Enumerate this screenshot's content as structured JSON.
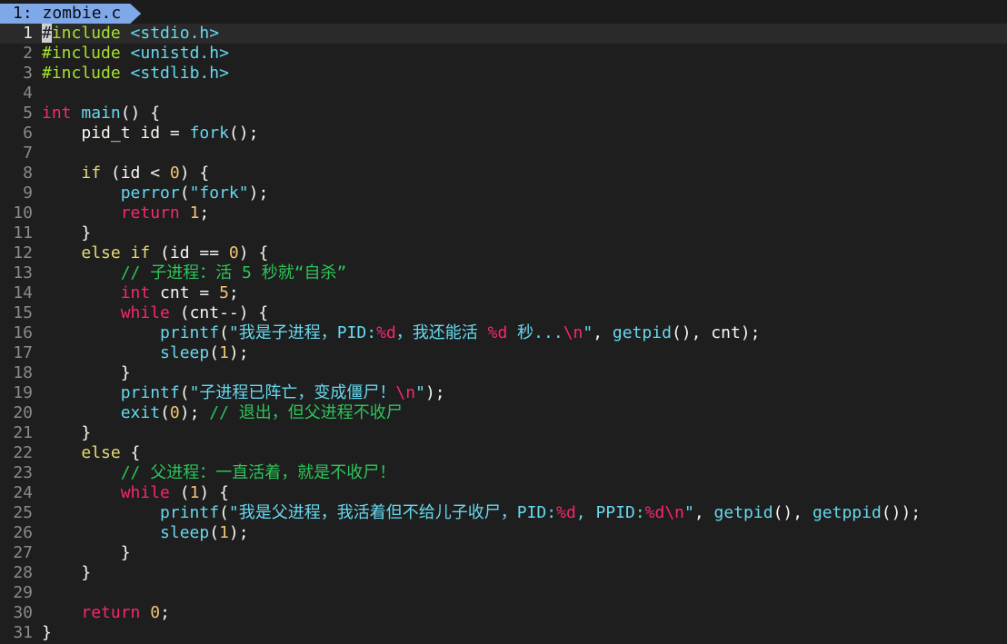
{
  "tab": {
    "label": "1: zombie.c"
  },
  "colors": {
    "tab_bg": "#7fa8e8",
    "background": "#1e1e1e",
    "comment": "#2cc55a"
  },
  "lines": [
    {
      "n": "1",
      "current": true,
      "parts": [
        [
          "cursor",
          "#"
        ],
        [
          "pp",
          "include"
        ],
        [
          "txt",
          " "
        ],
        [
          "hdr",
          "<stdio.h>"
        ]
      ]
    },
    {
      "n": "2",
      "parts": [
        [
          "pp",
          "#include"
        ],
        [
          "txt",
          " "
        ],
        [
          "hdr",
          "<unistd.h>"
        ]
      ]
    },
    {
      "n": "3",
      "parts": [
        [
          "pp",
          "#include"
        ],
        [
          "txt",
          " "
        ],
        [
          "hdr",
          "<stdlib.h>"
        ]
      ]
    },
    {
      "n": "4",
      "parts": []
    },
    {
      "n": "5",
      "parts": [
        [
          "kw",
          "int"
        ],
        [
          "txt",
          " "
        ],
        [
          "fn",
          "main"
        ],
        [
          "txt",
          "() {"
        ]
      ]
    },
    {
      "n": "6",
      "parts": [
        [
          "txt",
          "    pid_t id = "
        ],
        [
          "fn",
          "fork"
        ],
        [
          "txt",
          "();"
        ]
      ]
    },
    {
      "n": "7",
      "parts": []
    },
    {
      "n": "8",
      "parts": [
        [
          "txt",
          "    "
        ],
        [
          "kw2",
          "if"
        ],
        [
          "txt",
          " (id < "
        ],
        [
          "num",
          "0"
        ],
        [
          "txt",
          ") {"
        ]
      ]
    },
    {
      "n": "9",
      "parts": [
        [
          "txt",
          "        "
        ],
        [
          "fn",
          "perror"
        ],
        [
          "txt",
          "("
        ],
        [
          "str",
          "\"fork\""
        ],
        [
          "txt",
          ");"
        ]
      ]
    },
    {
      "n": "10",
      "parts": [
        [
          "txt",
          "        "
        ],
        [
          "kw",
          "return"
        ],
        [
          "txt",
          " "
        ],
        [
          "num",
          "1"
        ],
        [
          "txt",
          ";"
        ]
      ]
    },
    {
      "n": "11",
      "parts": [
        [
          "txt",
          "    }"
        ]
      ]
    },
    {
      "n": "12",
      "parts": [
        [
          "txt",
          "    "
        ],
        [
          "kw2",
          "else if"
        ],
        [
          "txt",
          " (id == "
        ],
        [
          "num",
          "0"
        ],
        [
          "txt",
          ") {"
        ]
      ]
    },
    {
      "n": "13",
      "parts": [
        [
          "txt",
          "        "
        ],
        [
          "cm",
          "// 子进程：活 5 秒就“自杀”"
        ]
      ]
    },
    {
      "n": "14",
      "parts": [
        [
          "txt",
          "        "
        ],
        [
          "kw",
          "int"
        ],
        [
          "txt",
          " cnt = "
        ],
        [
          "num",
          "5"
        ],
        [
          "txt",
          ";"
        ]
      ]
    },
    {
      "n": "15",
      "parts": [
        [
          "txt",
          "        "
        ],
        [
          "kw",
          "while"
        ],
        [
          "txt",
          " (cnt--) {"
        ]
      ]
    },
    {
      "n": "16",
      "parts": [
        [
          "txt",
          "            "
        ],
        [
          "fn",
          "printf"
        ],
        [
          "txt",
          "("
        ],
        [
          "str",
          "\"我是子进程，PID:"
        ],
        [
          "fmt",
          "%d"
        ],
        [
          "str",
          "，我还能活 "
        ],
        [
          "fmt",
          "%d"
        ],
        [
          "str",
          " 秒..."
        ],
        [
          "fmt",
          "\\n"
        ],
        [
          "str",
          "\""
        ],
        [
          "txt",
          ", "
        ],
        [
          "fn",
          "getpid"
        ],
        [
          "txt",
          "(), cnt);"
        ]
      ]
    },
    {
      "n": "17",
      "parts": [
        [
          "txt",
          "            "
        ],
        [
          "fn",
          "sleep"
        ],
        [
          "txt",
          "("
        ],
        [
          "num",
          "1"
        ],
        [
          "txt",
          ");"
        ]
      ]
    },
    {
      "n": "18",
      "parts": [
        [
          "txt",
          "        }"
        ]
      ]
    },
    {
      "n": "19",
      "parts": [
        [
          "txt",
          "        "
        ],
        [
          "fn",
          "printf"
        ],
        [
          "txt",
          "("
        ],
        [
          "str",
          "\"子进程已阵亡，变成僵尸！"
        ],
        [
          "fmt",
          "\\n"
        ],
        [
          "str",
          "\""
        ],
        [
          "txt",
          ");"
        ]
      ]
    },
    {
      "n": "20",
      "parts": [
        [
          "txt",
          "        "
        ],
        [
          "fn",
          "exit"
        ],
        [
          "txt",
          "("
        ],
        [
          "num",
          "0"
        ],
        [
          "txt",
          "); "
        ],
        [
          "cm",
          "// 退出，但父进程不收尸"
        ]
      ]
    },
    {
      "n": "21",
      "parts": [
        [
          "txt",
          "    }"
        ]
      ]
    },
    {
      "n": "22",
      "parts": [
        [
          "txt",
          "    "
        ],
        [
          "kw2",
          "else"
        ],
        [
          "txt",
          " {"
        ]
      ]
    },
    {
      "n": "23",
      "parts": [
        [
          "txt",
          "        "
        ],
        [
          "cm",
          "// 父进程：一直活着，就是不收尸！"
        ]
      ]
    },
    {
      "n": "24",
      "parts": [
        [
          "txt",
          "        "
        ],
        [
          "kw",
          "while"
        ],
        [
          "txt",
          " ("
        ],
        [
          "num",
          "1"
        ],
        [
          "txt",
          ") {"
        ]
      ]
    },
    {
      "n": "25",
      "parts": [
        [
          "txt",
          "            "
        ],
        [
          "fn",
          "printf"
        ],
        [
          "txt",
          "("
        ],
        [
          "str",
          "\"我是父进程，我活着但不给儿子收尸，PID:"
        ],
        [
          "fmt",
          "%d"
        ],
        [
          "str",
          ", PPID:"
        ],
        [
          "fmt",
          "%d\\n"
        ],
        [
          "str",
          "\""
        ],
        [
          "txt",
          ", "
        ],
        [
          "fn",
          "getpid"
        ],
        [
          "txt",
          "(), "
        ],
        [
          "fn",
          "getppid"
        ],
        [
          "txt",
          "());"
        ]
      ]
    },
    {
      "n": "26",
      "parts": [
        [
          "txt",
          "            "
        ],
        [
          "fn",
          "sleep"
        ],
        [
          "txt",
          "("
        ],
        [
          "num",
          "1"
        ],
        [
          "txt",
          ");"
        ]
      ]
    },
    {
      "n": "27",
      "parts": [
        [
          "txt",
          "        }"
        ]
      ]
    },
    {
      "n": "28",
      "parts": [
        [
          "txt",
          "    }"
        ]
      ]
    },
    {
      "n": "29",
      "parts": []
    },
    {
      "n": "30",
      "parts": [
        [
          "txt",
          "    "
        ],
        [
          "kw",
          "return"
        ],
        [
          "txt",
          " "
        ],
        [
          "num",
          "0"
        ],
        [
          "txt",
          ";"
        ]
      ]
    },
    {
      "n": "31",
      "parts": [
        [
          "txt",
          "}"
        ]
      ]
    }
  ]
}
